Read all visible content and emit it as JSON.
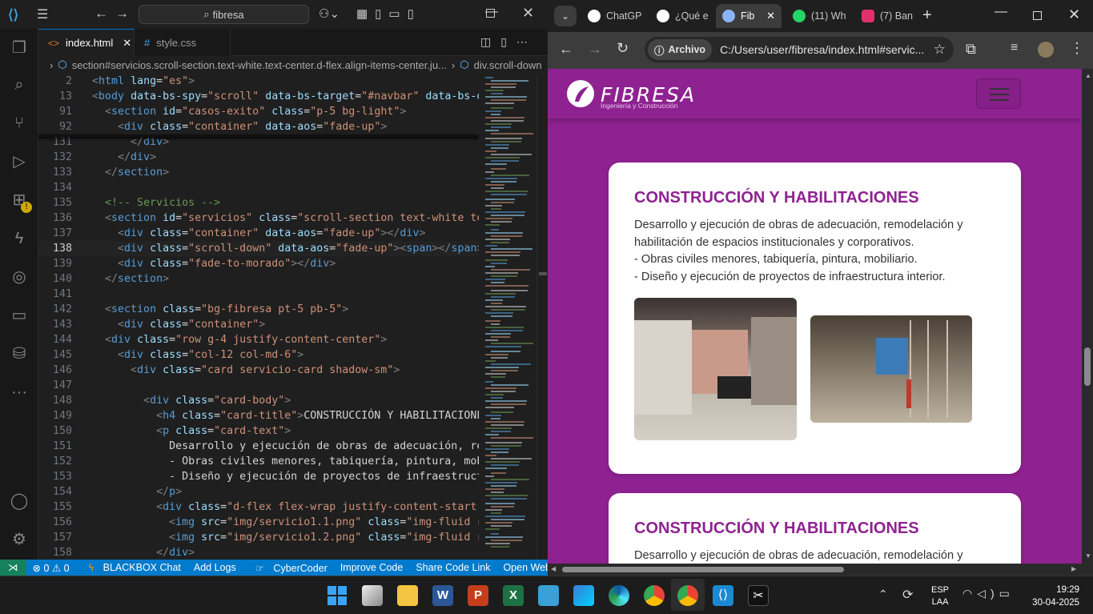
{
  "vscode": {
    "search": "fibresa",
    "tabs": [
      {
        "label": "index.html"
      },
      {
        "label": "style.css"
      }
    ],
    "breadcrumb": {
      "path1": "section#servicios.scroll-section.text-white.text-center.d-flex.align-items-center.ju...",
      "path2": "div.scroll-down"
    },
    "lines": [
      {
        "n": "2",
        "parts": [
          [
            "t",
            "<"
          ],
          [
            "tg",
            "html"
          ],
          [
            "tx",
            " "
          ],
          [
            "at",
            "lang"
          ],
          [
            "tx",
            "="
          ],
          [
            "vl",
            "\"es\""
          ],
          [
            "t",
            ">"
          ]
        ]
      },
      {
        "n": "13",
        "parts": [
          [
            "t",
            "<"
          ],
          [
            "tg",
            "body"
          ],
          [
            "tx",
            " "
          ],
          [
            "at",
            "data-bs-spy"
          ],
          [
            "tx",
            "="
          ],
          [
            "vl",
            "\"scroll\""
          ],
          [
            "tx",
            " "
          ],
          [
            "at",
            "data-bs-target"
          ],
          [
            "tx",
            "="
          ],
          [
            "vl",
            "\"#navbar\""
          ],
          [
            "tx",
            " "
          ],
          [
            "at",
            "data-bs-off"
          ]
        ]
      },
      {
        "n": "91",
        "parts": [
          [
            "tx",
            "  "
          ],
          [
            "t",
            "<"
          ],
          [
            "tg",
            "section"
          ],
          [
            "tx",
            " "
          ],
          [
            "at",
            "id"
          ],
          [
            "tx",
            "="
          ],
          [
            "vl",
            "\"casos-exito\""
          ],
          [
            "tx",
            " "
          ],
          [
            "at",
            "class"
          ],
          [
            "tx",
            "="
          ],
          [
            "vl",
            "\"p-5 bg-light\""
          ],
          [
            "t",
            ">"
          ]
        ]
      },
      {
        "n": "92",
        "parts": [
          [
            "tx",
            "    "
          ],
          [
            "t",
            "<"
          ],
          [
            "tg",
            "div"
          ],
          [
            "tx",
            " "
          ],
          [
            "at",
            "class"
          ],
          [
            "tx",
            "="
          ],
          [
            "vl",
            "\"container\""
          ],
          [
            "tx",
            " "
          ],
          [
            "at",
            "data-aos"
          ],
          [
            "tx",
            "="
          ],
          [
            "vl",
            "\"fade-up\""
          ],
          [
            "t",
            ">"
          ]
        ]
      },
      {
        "n": "131",
        "parts": [
          [
            "tx",
            "      "
          ],
          [
            "t",
            "</"
          ],
          [
            "tg",
            "div"
          ],
          [
            "t",
            ">"
          ]
        ]
      },
      {
        "n": "132",
        "parts": [
          [
            "tx",
            "    "
          ],
          [
            "t",
            "</"
          ],
          [
            "tg",
            "div"
          ],
          [
            "t",
            ">"
          ]
        ]
      },
      {
        "n": "133",
        "parts": [
          [
            "tx",
            "  "
          ],
          [
            "t",
            "</"
          ],
          [
            "tg",
            "section"
          ],
          [
            "t",
            ">"
          ]
        ]
      },
      {
        "n": "134",
        "parts": []
      },
      {
        "n": "135",
        "parts": [
          [
            "tx",
            "  "
          ],
          [
            "cm",
            "<!-- Servicios -->"
          ]
        ]
      },
      {
        "n": "136",
        "parts": [
          [
            "tx",
            "  "
          ],
          [
            "t",
            "<"
          ],
          [
            "tg",
            "section"
          ],
          [
            "tx",
            " "
          ],
          [
            "at",
            "id"
          ],
          [
            "tx",
            "="
          ],
          [
            "vl",
            "\"servicios\""
          ],
          [
            "tx",
            " "
          ],
          [
            "at",
            "class"
          ],
          [
            "tx",
            "="
          ],
          [
            "vl",
            "\"scroll-section text-white text"
          ]
        ]
      },
      {
        "n": "137",
        "parts": [
          [
            "tx",
            "    "
          ],
          [
            "t",
            "<"
          ],
          [
            "tg",
            "div"
          ],
          [
            "tx",
            " "
          ],
          [
            "at",
            "class"
          ],
          [
            "tx",
            "="
          ],
          [
            "vl",
            "\"container\""
          ],
          [
            "tx",
            " "
          ],
          [
            "at",
            "data-aos"
          ],
          [
            "tx",
            "="
          ],
          [
            "vl",
            "\"fade-up\""
          ],
          [
            "t",
            "></"
          ],
          [
            "tg",
            "div"
          ],
          [
            "t",
            ">"
          ]
        ]
      },
      {
        "n": "138",
        "cur": true,
        "parts": [
          [
            "tx",
            "    "
          ],
          [
            "t",
            "<"
          ],
          [
            "tg",
            "div"
          ],
          [
            "tx",
            " "
          ],
          [
            "at",
            "class"
          ],
          [
            "tx",
            "="
          ],
          [
            "vl",
            "\"scroll-down\""
          ],
          [
            "tx",
            " "
          ],
          [
            "at",
            "data-aos"
          ],
          [
            "tx",
            "="
          ],
          [
            "vl",
            "\"fade-up\""
          ],
          [
            "t",
            "><"
          ],
          [
            "tg",
            "span"
          ],
          [
            "t",
            "></"
          ],
          [
            "tg",
            "span"
          ],
          [
            "t",
            "></"
          ]
        ]
      },
      {
        "n": "139",
        "parts": [
          [
            "tx",
            "    "
          ],
          [
            "t",
            "<"
          ],
          [
            "tg",
            "div"
          ],
          [
            "tx",
            " "
          ],
          [
            "at",
            "class"
          ],
          [
            "tx",
            "="
          ],
          [
            "vl",
            "\"fade-to-morado\""
          ],
          [
            "t",
            "></"
          ],
          [
            "tg",
            "div"
          ],
          [
            "t",
            ">"
          ]
        ]
      },
      {
        "n": "140",
        "parts": [
          [
            "tx",
            "  "
          ],
          [
            "t",
            "</"
          ],
          [
            "tg",
            "section"
          ],
          [
            "t",
            ">"
          ]
        ]
      },
      {
        "n": "141",
        "parts": []
      },
      {
        "n": "142",
        "parts": [
          [
            "tx",
            "  "
          ],
          [
            "t",
            "<"
          ],
          [
            "tg",
            "section"
          ],
          [
            "tx",
            " "
          ],
          [
            "at",
            "class"
          ],
          [
            "tx",
            "="
          ],
          [
            "vl",
            "\"bg-fibresa pt-5 pb-5\""
          ],
          [
            "t",
            ">"
          ]
        ]
      },
      {
        "n": "143",
        "parts": [
          [
            "tx",
            "    "
          ],
          [
            "t",
            "<"
          ],
          [
            "tg",
            "div"
          ],
          [
            "tx",
            " "
          ],
          [
            "at",
            "class"
          ],
          [
            "tx",
            "="
          ],
          [
            "vl",
            "\"container\""
          ],
          [
            "t",
            ">"
          ]
        ]
      },
      {
        "n": "144",
        "parts": [
          [
            "tx",
            "  "
          ],
          [
            "t",
            "<"
          ],
          [
            "tg",
            "div"
          ],
          [
            "tx",
            " "
          ],
          [
            "at",
            "class"
          ],
          [
            "tx",
            "="
          ],
          [
            "vl",
            "\"row g-4 justify-content-center\""
          ],
          [
            "t",
            ">"
          ]
        ]
      },
      {
        "n": "145",
        "parts": [
          [
            "tx",
            "    "
          ],
          [
            "t",
            "<"
          ],
          [
            "tg",
            "div"
          ],
          [
            "tx",
            " "
          ],
          [
            "at",
            "class"
          ],
          [
            "tx",
            "="
          ],
          [
            "vl",
            "\"col-12 col-md-6\""
          ],
          [
            "t",
            ">"
          ]
        ]
      },
      {
        "n": "146",
        "parts": [
          [
            "tx",
            "      "
          ],
          [
            "t",
            "<"
          ],
          [
            "tg",
            "div"
          ],
          [
            "tx",
            " "
          ],
          [
            "at",
            "class"
          ],
          [
            "tx",
            "="
          ],
          [
            "vl",
            "\"card servicio-card shadow-sm\""
          ],
          [
            "t",
            ">"
          ]
        ]
      },
      {
        "n": "147",
        "parts": []
      },
      {
        "n": "148",
        "parts": [
          [
            "tx",
            "        "
          ],
          [
            "t",
            "<"
          ],
          [
            "tg",
            "div"
          ],
          [
            "tx",
            " "
          ],
          [
            "at",
            "class"
          ],
          [
            "tx",
            "="
          ],
          [
            "vl",
            "\"card-body\""
          ],
          [
            "t",
            ">"
          ]
        ]
      },
      {
        "n": "149",
        "parts": [
          [
            "tx",
            "          "
          ],
          [
            "t",
            "<"
          ],
          [
            "tg",
            "h4"
          ],
          [
            "tx",
            " "
          ],
          [
            "at",
            "class"
          ],
          [
            "tx",
            "="
          ],
          [
            "vl",
            "\"card-title\""
          ],
          [
            "t",
            ">"
          ],
          [
            "tx",
            "CONSTRUCCIÓN Y HABILITACIONES"
          ],
          [
            "t",
            "<"
          ]
        ]
      },
      {
        "n": "150",
        "parts": [
          [
            "tx",
            "          "
          ],
          [
            "t",
            "<"
          ],
          [
            "tg",
            "p"
          ],
          [
            "tx",
            " "
          ],
          [
            "at",
            "class"
          ],
          [
            "tx",
            "="
          ],
          [
            "vl",
            "\"card-text\""
          ],
          [
            "t",
            ">"
          ]
        ]
      },
      {
        "n": "151",
        "parts": [
          [
            "tx",
            "            Desarrollo y ejecución de obras de adecuación, remo"
          ]
        ]
      },
      {
        "n": "152",
        "parts": [
          [
            "tx",
            "            - Obras civiles menores, tabiquería, pintura, mobil"
          ]
        ]
      },
      {
        "n": "153",
        "parts": [
          [
            "tx",
            "            - Diseño y ejecución de proyectos de infraestructur"
          ]
        ]
      },
      {
        "n": "154",
        "parts": [
          [
            "tx",
            "          "
          ],
          [
            "t",
            "</"
          ],
          [
            "tg",
            "p"
          ],
          [
            "t",
            ">"
          ]
        ]
      },
      {
        "n": "155",
        "parts": [
          [
            "tx",
            "          "
          ],
          [
            "t",
            "<"
          ],
          [
            "tg",
            "div"
          ],
          [
            "tx",
            " "
          ],
          [
            "at",
            "class"
          ],
          [
            "tx",
            "="
          ],
          [
            "vl",
            "\"d-flex flex-wrap justify-content-start al"
          ]
        ]
      },
      {
        "n": "156",
        "parts": [
          [
            "tx",
            "            "
          ],
          [
            "t",
            "<"
          ],
          [
            "tg",
            "img"
          ],
          [
            "tx",
            " "
          ],
          [
            "at",
            "src"
          ],
          [
            "tx",
            "="
          ],
          [
            "vl",
            "\"img/servicio1.1.png\""
          ],
          [
            "tx",
            " "
          ],
          [
            "at",
            "class"
          ],
          [
            "tx",
            "="
          ],
          [
            "vl",
            "\"img-fluid rou"
          ]
        ]
      },
      {
        "n": "157",
        "parts": [
          [
            "tx",
            "            "
          ],
          [
            "t",
            "<"
          ],
          [
            "tg",
            "img"
          ],
          [
            "tx",
            " "
          ],
          [
            "at",
            "src"
          ],
          [
            "tx",
            "="
          ],
          [
            "vl",
            "\"img/servicio1.2.png\""
          ],
          [
            "tx",
            " "
          ],
          [
            "at",
            "class"
          ],
          [
            "tx",
            "="
          ],
          [
            "vl",
            "\"img-fluid rou"
          ]
        ]
      },
      {
        "n": "158",
        "parts": [
          [
            "tx",
            "          "
          ],
          [
            "t",
            "</"
          ],
          [
            "tg",
            "div"
          ],
          [
            "t",
            ">"
          ]
        ]
      }
    ],
    "status": {
      "problems": "0",
      "warnings": "0",
      "items": [
        "BLACKBOX Chat",
        "Add Logs",
        "CyberCoder",
        "Improve Code",
        "Share Code Link",
        "Open Website"
      ]
    }
  },
  "browser": {
    "tabs": [
      {
        "label": "ChatGP",
        "color": "#ffffff"
      },
      {
        "label": "¿Qué e",
        "color": "#ffffff"
      },
      {
        "label": "Fib",
        "color": "#8ab4f8"
      },
      {
        "label": "(11) Wh",
        "color": "#25d366"
      },
      {
        "label": "(7) Ban",
        "color": "#e1306c"
      }
    ],
    "chip": "Archivo",
    "url": "C:/Users/user/fibresa/index.html#servic...",
    "site": {
      "logo": "FIBRESA",
      "tagline": "Ingeniería y Construcción",
      "cards": [
        {
          "title": "CONSTRUCCIÓN Y HABILITACIONES",
          "lines": [
            "Desarrollo y ejecución de obras de adecuación, remodelación y habilitación de espacios institucionales y corporativos.",
            "- Obras civiles menores, tabiquería, pintura, mobiliario.",
            "- Diseño y ejecución de proyectos de infraestructura interior."
          ]
        },
        {
          "title": "CONSTRUCCIÓN Y HABILITACIONES",
          "lines": [
            "Desarrollo y ejecución de obras de adecuación, remodelación y"
          ]
        }
      ],
      "brand_color": "#8f2291"
    }
  },
  "taskbar": {
    "lang": "ESP",
    "layout": "LAA",
    "time": "19:29",
    "date": "30-04-2025"
  }
}
